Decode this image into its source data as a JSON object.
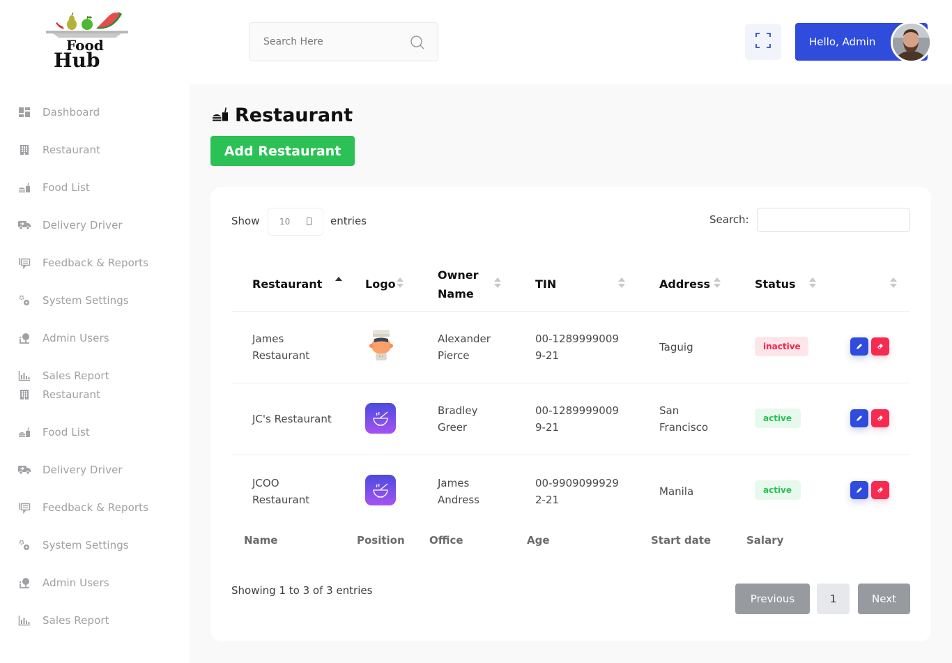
{
  "brand": {
    "line1": "Food",
    "line2": "Hub"
  },
  "sidebar": {
    "items": [
      {
        "label": "Dashboard",
        "icon": "dashboard-icon"
      },
      {
        "label": "Restaurant",
        "icon": "building-icon"
      },
      {
        "label": "Food List",
        "icon": "food-icon"
      },
      {
        "label": "Delivery Driver",
        "icon": "truck-icon"
      },
      {
        "label": "Feedback & Reports",
        "icon": "comments-icon"
      },
      {
        "label": "System Settings",
        "icon": "cogs-icon"
      },
      {
        "label": "Admin Users",
        "icon": "user-icon"
      },
      {
        "label": "Sales Report",
        "icon": "chart-icon"
      },
      {
        "label": "Restaurant",
        "icon": "building-icon"
      },
      {
        "label": "Food List",
        "icon": "food-icon"
      },
      {
        "label": "Delivery Driver",
        "icon": "truck-icon"
      },
      {
        "label": "Feedback & Reports",
        "icon": "comments-icon"
      },
      {
        "label": "System Settings",
        "icon": "cogs-icon"
      },
      {
        "label": "Admin Users",
        "icon": "user-icon"
      },
      {
        "label": "Sales Report",
        "icon": "chart-icon"
      }
    ]
  },
  "header": {
    "search_placeholder": "Search Here",
    "greeting": "Hello, Admin"
  },
  "page": {
    "title": "Restaurant",
    "add_button": "Add Restaurant"
  },
  "table_controls": {
    "show_label": "Show",
    "page_length": "10",
    "entries_label": "entries",
    "search_label": "Search:",
    "search_value": ""
  },
  "table": {
    "columns": [
      "Restaurant",
      "Logo",
      "Owner Name",
      "TIN",
      "Address",
      "Status",
      ""
    ],
    "rows": [
      {
        "restaurant": "James Restaurant",
        "logo": "chef-logo",
        "owner": "Alexander Pierce",
        "tin": "00-12899990099-21",
        "address": "Taguig",
        "status": "inactive"
      },
      {
        "restaurant": "JC's Restaurant",
        "logo": "bowl-logo",
        "owner": "Bradley Greer",
        "tin": "00-12899990099-21",
        "address": "San Francisco",
        "status": "active"
      },
      {
        "restaurant": "JCOO Restaurant",
        "logo": "bowl-logo",
        "owner": "James Andress",
        "tin": "00-99090999292-21",
        "address": "Manila",
        "status": "active"
      }
    ],
    "footer": [
      "Name",
      "Position",
      "Office",
      "Age",
      "Start date",
      "Salary"
    ]
  },
  "pagination": {
    "info": "Showing 1 to 3 of 3 entries",
    "previous": "Previous",
    "current_page": "1",
    "next": "Next"
  },
  "colors": {
    "primary": "#2f4cdd",
    "success": "#2bc155",
    "danger": "#f72b50"
  }
}
